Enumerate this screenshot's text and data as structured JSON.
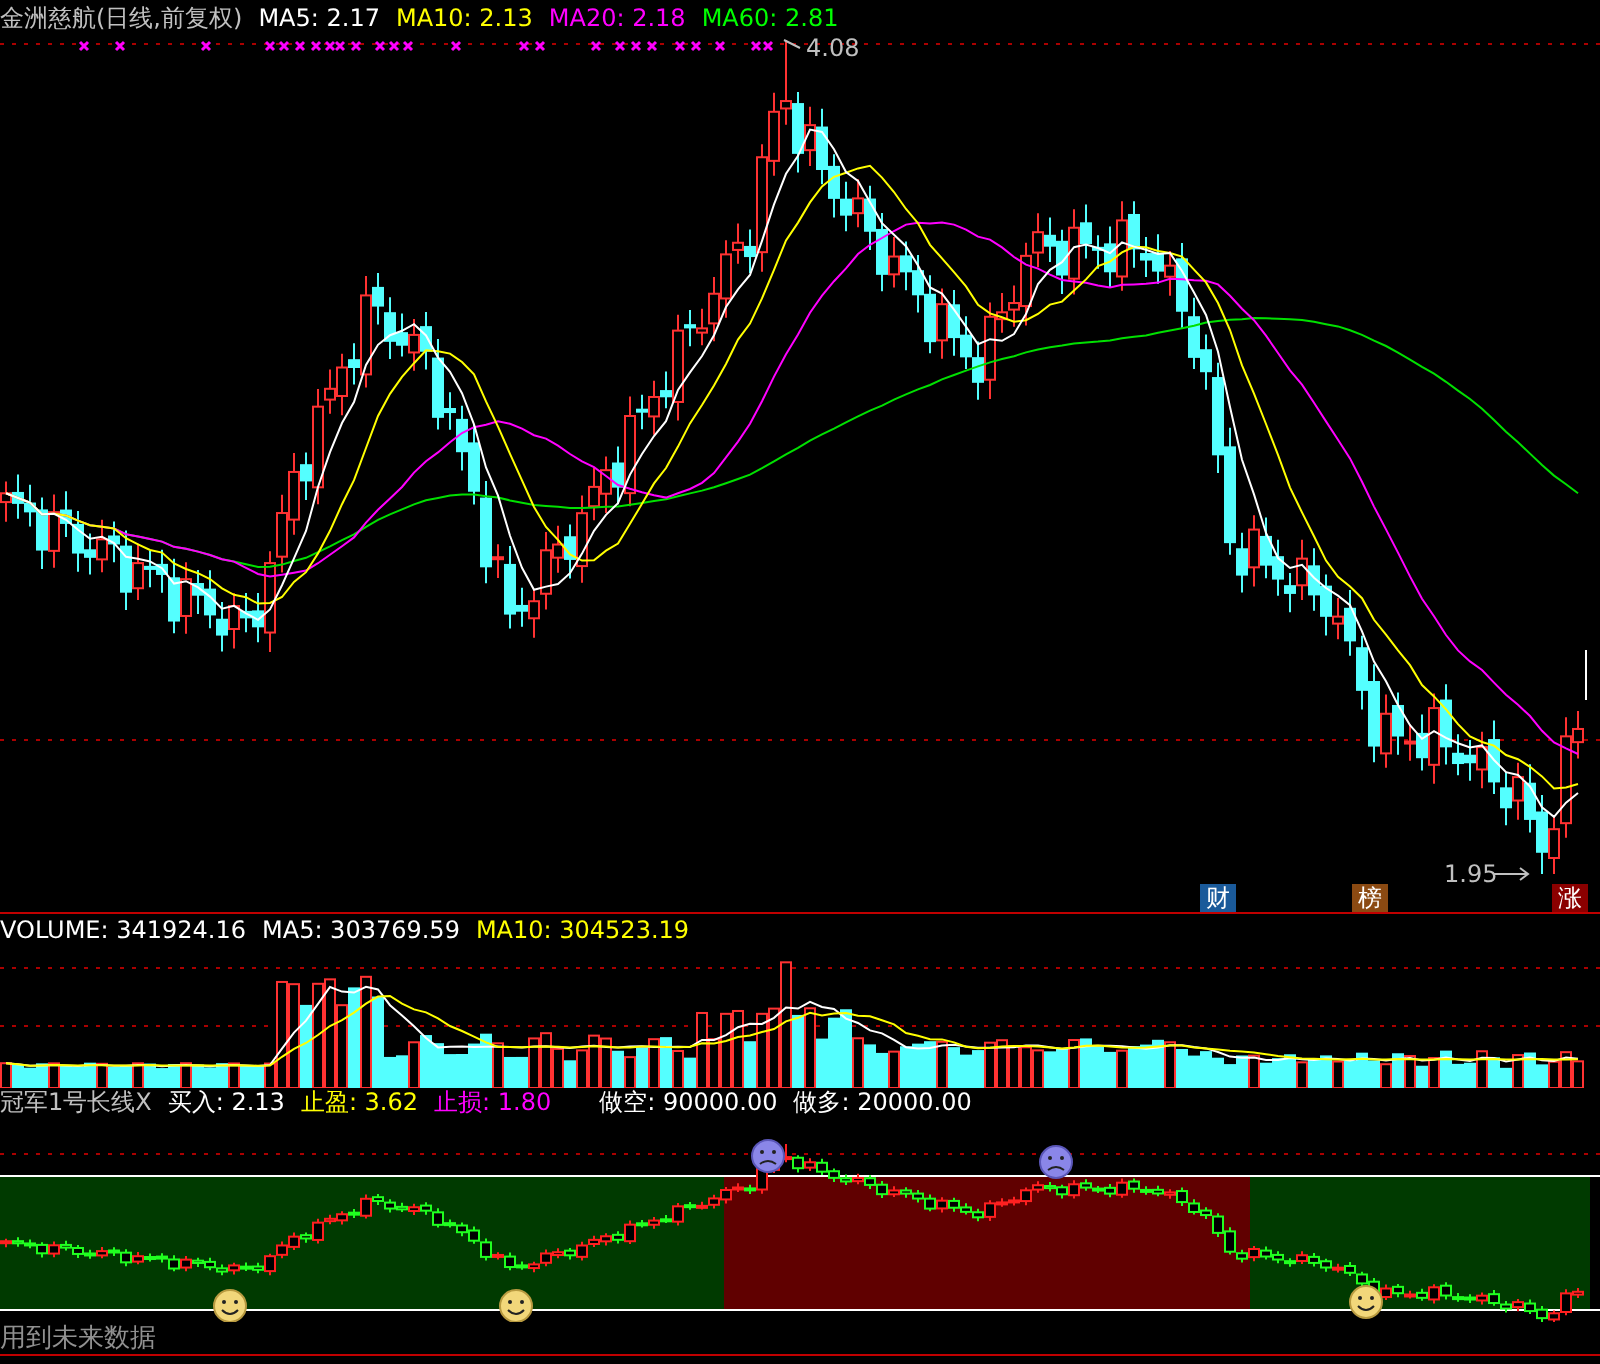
{
  "title": "金洲慈航(日线,前复权)",
  "ma": [
    {
      "label": "MA5: 2.17",
      "color": "#ffffff"
    },
    {
      "label": "MA10: 2.13",
      "color": "#ffff00"
    },
    {
      "label": "MA20: 2.18",
      "color": "#ff00ff"
    },
    {
      "label": "MA60: 2.81",
      "color": "#00ff00"
    }
  ],
  "annotations": {
    "high": "4.08",
    "low": "1.95"
  },
  "badges": [
    {
      "text": "财",
      "color": "#1a5a9a"
    },
    {
      "text": "榜",
      "color": "#8b4a12"
    },
    {
      "text": "涨",
      "color": "#8b0000"
    }
  ],
  "volume": {
    "label": "VOLUME: 341924.16",
    "ma": [
      {
        "label": "MA5: 303769.59",
        "color": "#ffffff"
      },
      {
        "label": "MA10: 304523.19",
        "color": "#ffff00"
      }
    ]
  },
  "indicator": {
    "name": "冠军1号长线X",
    "values": [
      {
        "label": "买入: 2.13",
        "color": "#ffffff"
      },
      {
        "label": "止盈: 3.62",
        "color": "#ffff00"
      },
      {
        "label": "止损: 1.80",
        "color": "#ff00ff"
      },
      {
        "label": "做空: 90000.00",
        "color": "#ffffff"
      },
      {
        "label": "做多: 20000.00",
        "color": "#ffffff"
      }
    ]
  },
  "footer": "用到未来数据"
}
